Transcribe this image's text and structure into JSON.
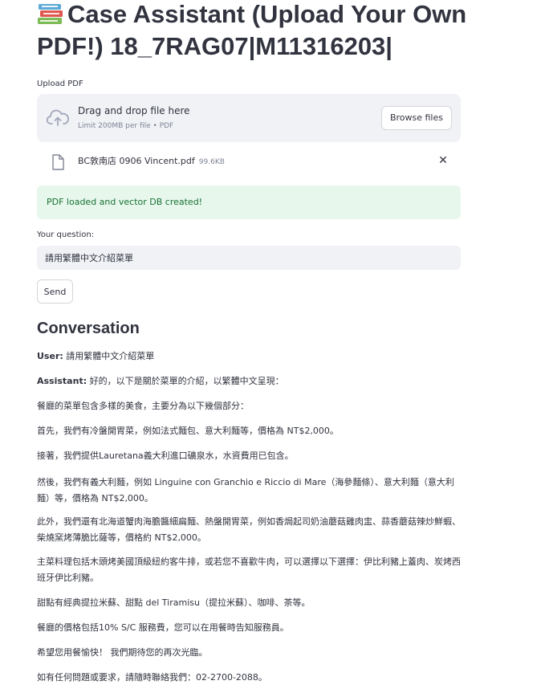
{
  "app": {
    "title": "Case Assistant (Upload Your Own PDF!) 18_7RAG07|M11316203|",
    "title_icon": "books-icon"
  },
  "uploader": {
    "label": "Upload PDF",
    "drag_text": "Drag and drop file here",
    "limit_text": "Limit 200MB per file • PDF",
    "browse_label": "Browse files",
    "icon": "cloud-upload-icon"
  },
  "file": {
    "name": "BC敦南店 0906 Vincent.pdf",
    "size": "99.6KB",
    "icon": "file-icon",
    "remove_icon": "close-icon"
  },
  "status": {
    "success_text": "PDF loaded and vector DB created!",
    "color": "#177233"
  },
  "question": {
    "label": "Your question:",
    "value": "請用繁體中文介紹菜單"
  },
  "send": {
    "label": "Send"
  },
  "conversation": {
    "title": "Conversation",
    "user_label": "User:",
    "user_text": " 請用繁體中文介紹菜單",
    "assistant_label": "Assistant:",
    "assistant_text": " 好的，以下是關於菜單的介紹，以繁體中文呈現：",
    "paragraphs": [
      "餐廳的菜單包含多樣的美食，主要分為以下幾個部分：",
      "首先，我們有冷盤開胃菜，例如法式麵包、意大利麵等，價格為 NT$2,000。",
      "接著，我們提供Lauretana義大利進口礦泉水，水資費用已包含。",
      "然後，我們有義大利麵，例如 Linguine con Granchio e Riccio di Mare（海參麵條）、意大利麵（意大利麵）等，價格為 NT$2,000。",
      "此外，我們還有北海道蟹肉海膽醬細扁麵、熱盤開胃菜，例如香焗起司奶油蘑菇雞肉盅、蒜香蘑菇辣炒鮮蝦、柴燒窯烤薄脆比薩等，價格約 NT$2,000。",
      "主菜料理包括木頭烤美國頂級紐約客牛排，或若您不喜歡牛肉，可以選擇以下選擇：伊比利豬上蓋肉、炭烤西班牙伊比利豬。",
      "甜點有經典提拉米蘇、甜點 del Tiramisu（提拉米蘇）、咖啡、茶等。",
      "餐廳的價格包括10% S/C 服務費，您可以在用餐時告知服務員。",
      "希望您用餐愉快！ 我們期待您的再次光臨。",
      "如有任何問題或要求，請隨時聯絡我們：02-2700-2088。"
    ]
  }
}
